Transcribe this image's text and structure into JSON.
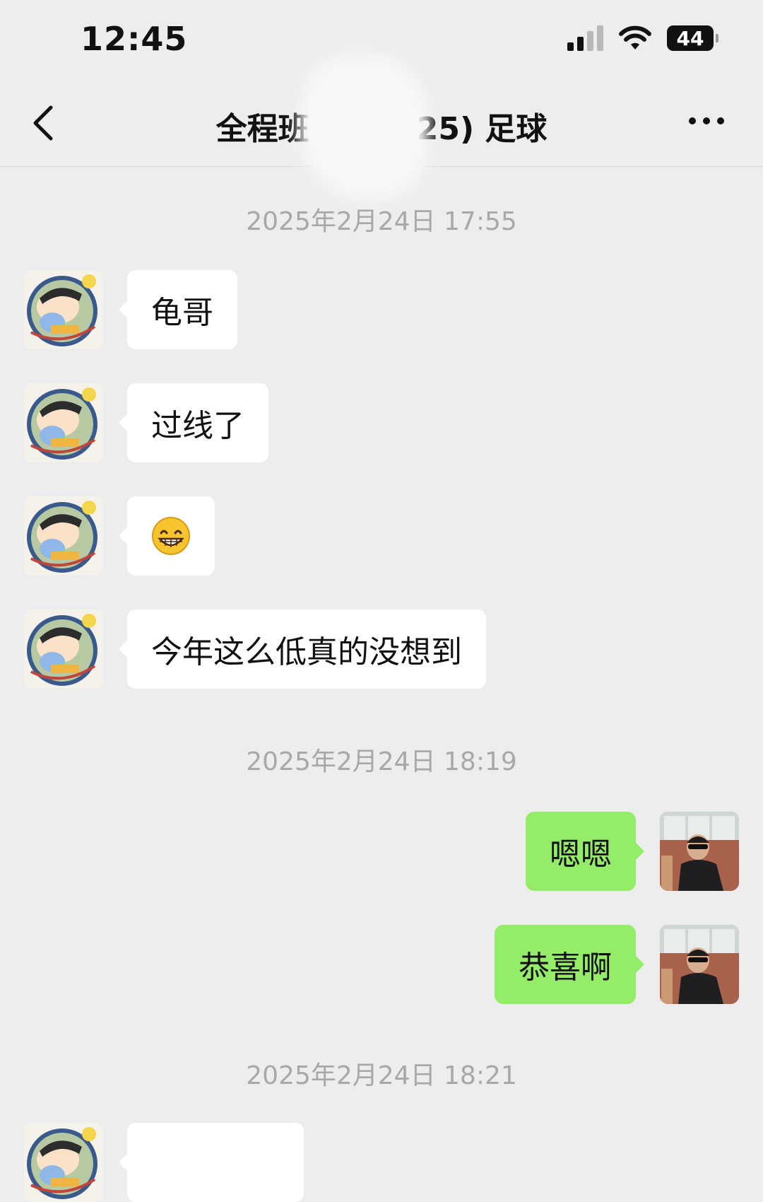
{
  "status_bar": {
    "time": "12:45",
    "battery_level": "44"
  },
  "nav": {
    "title": "全程班　　　(25) 足球"
  },
  "timestamps": [
    "2025年2月24日 17:55",
    "2025年2月24日 18:19",
    "2025年2月24日 18:21"
  ],
  "messages": [
    {
      "side": "left",
      "text": "龟哥"
    },
    {
      "side": "left",
      "text": "过线了"
    },
    {
      "side": "left",
      "emoji": "grinning-face"
    },
    {
      "side": "left",
      "text": "今年这么低真的没想到"
    },
    {
      "side": "right",
      "text": "嗯嗯"
    },
    {
      "side": "right",
      "text": "恭喜啊"
    }
  ],
  "colors": {
    "background": "#ededed",
    "incoming_bubble": "#ffffff",
    "outgoing_bubble": "#95ec69",
    "timestamp_text": "#a8a8a8"
  },
  "icons": {
    "back": "chevron-left-icon",
    "more": "more-dots-icon",
    "signal": "cellular-signal-icon",
    "wifi": "wifi-icon",
    "battery": "battery-icon"
  }
}
